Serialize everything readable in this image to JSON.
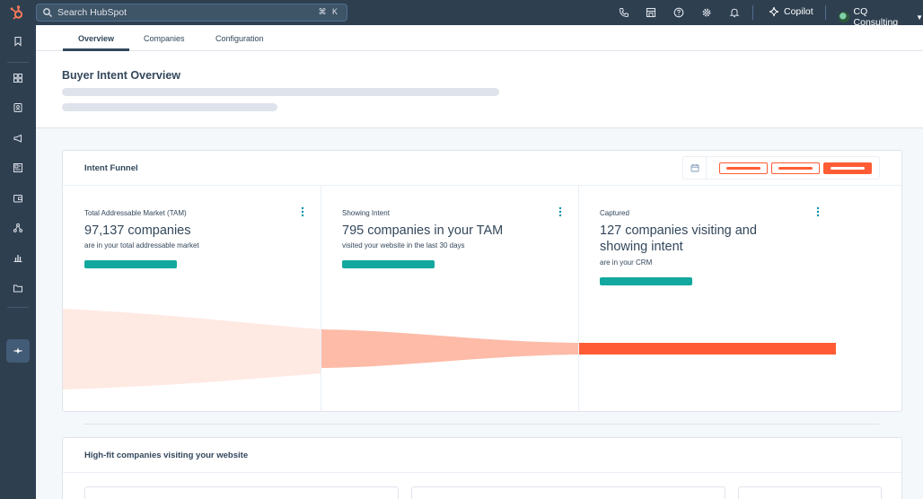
{
  "topbar": {
    "search_placeholder": "Search HubSpot",
    "search_shortcut": "⌘ K",
    "copilot_label": "Copilot",
    "account_name": "CQ Consulting"
  },
  "tabs": [
    {
      "label": "Overview",
      "active": true
    },
    {
      "label": "Companies",
      "active": false
    },
    {
      "label": "Configuration",
      "active": false
    }
  ],
  "page": {
    "title": "Buyer Intent Overview"
  },
  "intent_funnel": {
    "title": "Intent Funnel",
    "stages": [
      {
        "label": "Total Addressable Market (TAM)",
        "headline": "97,137 companies",
        "subtext": "are in your total addressable market"
      },
      {
        "label": "Showing Intent",
        "headline": "795 companies in your TAM",
        "subtext": "visited your website in the last 30 days"
      },
      {
        "label": "Captured",
        "headline": "127 companies visiting and showing intent",
        "subtext": "are in your CRM"
      }
    ]
  },
  "high_fit": {
    "title": "High-fit companies visiting your website"
  },
  "colors": {
    "nav_bg": "#2e3f50",
    "accent_orange": "#ff5c35",
    "teal": "#13a89e",
    "funnel_light": "#ffe9e3",
    "funnel_mid": "#fdbba8",
    "funnel_strong": "#ff5c35"
  },
  "icons": [
    "hubspot-logo-icon",
    "search-icon",
    "phone-icon",
    "marketplace-icon",
    "help-icon",
    "settings-icon",
    "bell-icon",
    "copilot-sparkle-icon",
    "bookmark-icon",
    "dashboard-icon",
    "contacts-icon",
    "megaphone-icon",
    "content-icon",
    "commerce-icon",
    "automation-icon",
    "reports-icon",
    "folder-icon",
    "breeze-icon",
    "calendar-icon",
    "kebab-menu-icon"
  ]
}
